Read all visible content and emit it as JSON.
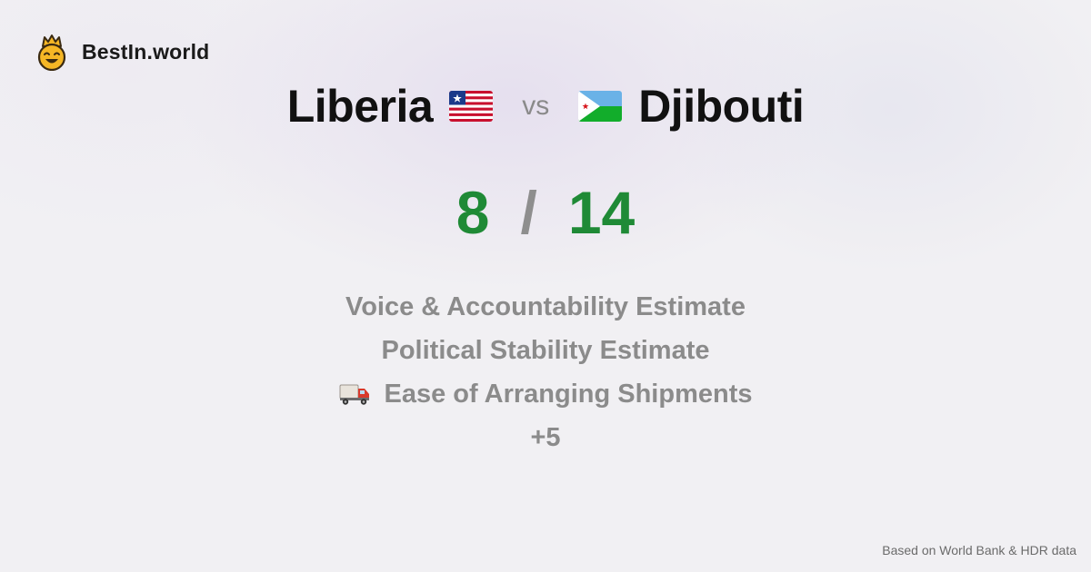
{
  "brand": {
    "name": "BestIn.world",
    "logo_icon": "crowned-smiley-icon"
  },
  "comparison": {
    "left_country": "Liberia",
    "left_flag_icon": "liberia-flag-icon",
    "vs_label": "vs",
    "right_country": "Djibouti",
    "right_flag_icon": "djibouti-flag-icon"
  },
  "scores": {
    "left": "8",
    "separator": "/",
    "right": "14",
    "color": "#1f8a36"
  },
  "metrics": [
    {
      "label": "Voice & Accountability Estimate"
    },
    {
      "label": "Political Stability Estimate"
    },
    {
      "label": "Ease of Arranging Shipments",
      "icon": "truck-icon"
    }
  ],
  "more_label": "+5",
  "footer": {
    "source": "Based on World Bank & HDR data"
  }
}
